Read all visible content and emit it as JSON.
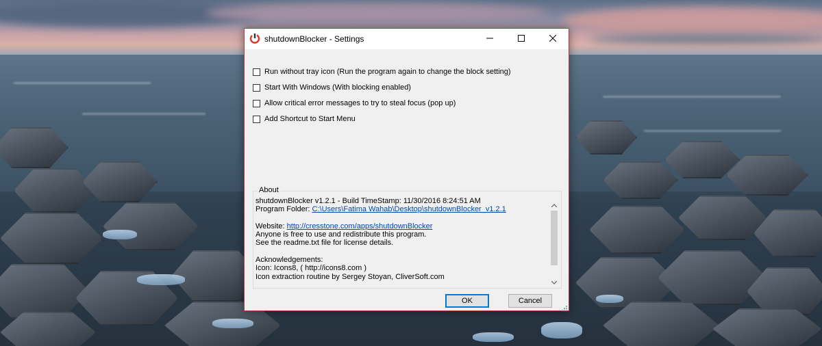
{
  "window": {
    "title": "shutdownBlocker - Settings",
    "border_color": "#b3414a"
  },
  "options": [
    {
      "label": "Run without tray icon (Run the program again to change the block setting)",
      "checked": false
    },
    {
      "label": "Start With Windows (With blocking enabled)",
      "checked": false
    },
    {
      "label": "Allow critical error messages to try to steal focus (pop up)",
      "checked": false
    },
    {
      "label": "Add Shortcut to Start Menu",
      "checked": false
    }
  ],
  "about": {
    "legend": "About",
    "version_line": "shutdownBlocker v1.2.1   -   Build TimeStamp: 11/30/2016 8:24:51 AM",
    "folder_label": "Program Folder: ",
    "folder_path": "C:\\Users\\Fatima Wahab\\Desktop\\shutdownBlocker_v1.2.1",
    "website_label": "Website: ",
    "website_url": "http://cresstone.com/apps/shutdownBlocker",
    "line_free": "Anyone is free to use and redistribute this program.",
    "line_readme": "See the readme.txt file for license details.",
    "ack_heading": "Acknowledgements:",
    "ack_icon": "Icon: Icons8, ( http://icons8.com )",
    "ack_extract": "Icon extraction routine by Sergey Stoyan, CliverSoft.com"
  },
  "buttons": {
    "ok": "OK",
    "cancel": "Cancel"
  },
  "icons": {
    "app": "power-app-icon",
    "minimize": "minimize-icon",
    "maximize": "maximize-icon",
    "close": "close-icon"
  },
  "colors": {
    "link": "#0645ad",
    "default_button_border": "#0078d7"
  }
}
